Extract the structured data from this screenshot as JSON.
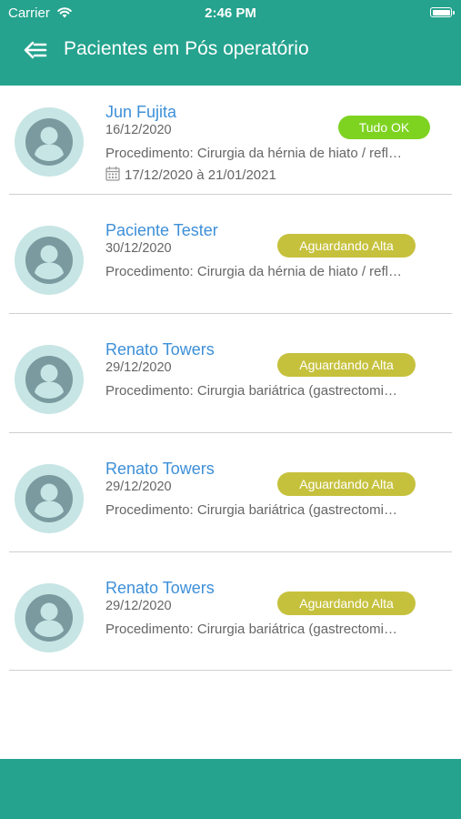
{
  "status_bar": {
    "carrier": "Carrier",
    "time": "2:46 PM"
  },
  "header": {
    "title": "Pacientes em Pós operatório"
  },
  "colors": {
    "primary": "#25a38e",
    "name": "#3d8fd8",
    "badge_ok": "#7ed321",
    "badge_waiting": "#c6c13d"
  },
  "patients": [
    {
      "name": "Jun Fujita",
      "date": "16/12/2020",
      "procedure": "Procedimento: Cirurgia da hérnia de hiato / refl…",
      "period": "17/12/2020 à 21/01/2021",
      "status": "Tudo OK",
      "status_type": "ok"
    },
    {
      "name": "Paciente Tester",
      "date": "30/12/2020",
      "procedure": "Procedimento: Cirurgia da hérnia de hiato / refl…",
      "status": "Aguardando Alta",
      "status_type": "waiting"
    },
    {
      "name": "Renato Towers",
      "date": "29/12/2020",
      "procedure": "Procedimento: Cirurgia bariátrica (gastrectomi…",
      "status": "Aguardando Alta",
      "status_type": "waiting"
    },
    {
      "name": "Renato Towers",
      "date": "29/12/2020",
      "procedure": "Procedimento: Cirurgia bariátrica (gastrectomi…",
      "status": "Aguardando Alta",
      "status_type": "waiting"
    },
    {
      "name": "Renato Towers",
      "date": "29/12/2020",
      "procedure": "Procedimento: Cirurgia bariátrica (gastrectomi…",
      "status": "Aguardando Alta",
      "status_type": "waiting"
    }
  ]
}
